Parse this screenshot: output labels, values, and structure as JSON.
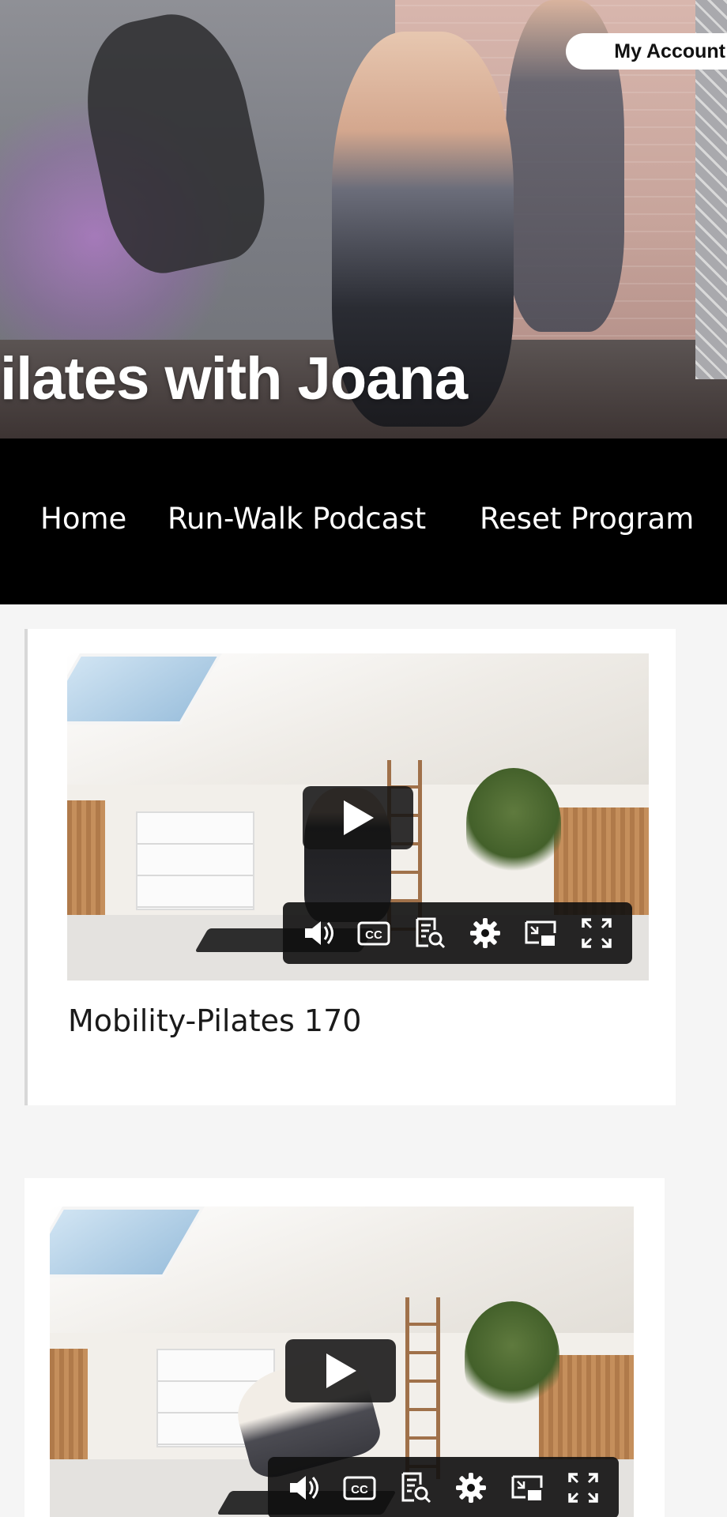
{
  "hero": {
    "title": "ilates with Joana",
    "account_button": "My Account"
  },
  "nav": {
    "items": [
      "Home",
      "Run-Walk Podcast",
      "Reset Program"
    ]
  },
  "videos": [
    {
      "title": "Mobility-Pilates 170",
      "controls": [
        "volume-icon",
        "captions-icon",
        "transcript-icon",
        "settings-icon",
        "picture-in-picture-icon",
        "fullscreen-icon"
      ],
      "captions_label": "CC"
    },
    {
      "title": "",
      "controls": [
        "volume-icon",
        "captions-icon",
        "transcript-icon",
        "settings-icon",
        "picture-in-picture-icon",
        "fullscreen-icon"
      ],
      "captions_label": "CC"
    }
  ],
  "colors": {
    "nav_background": "#000000",
    "page_background": "#f5f5f5",
    "card_background": "#ffffff",
    "control_bar": "#0f0f0f"
  }
}
